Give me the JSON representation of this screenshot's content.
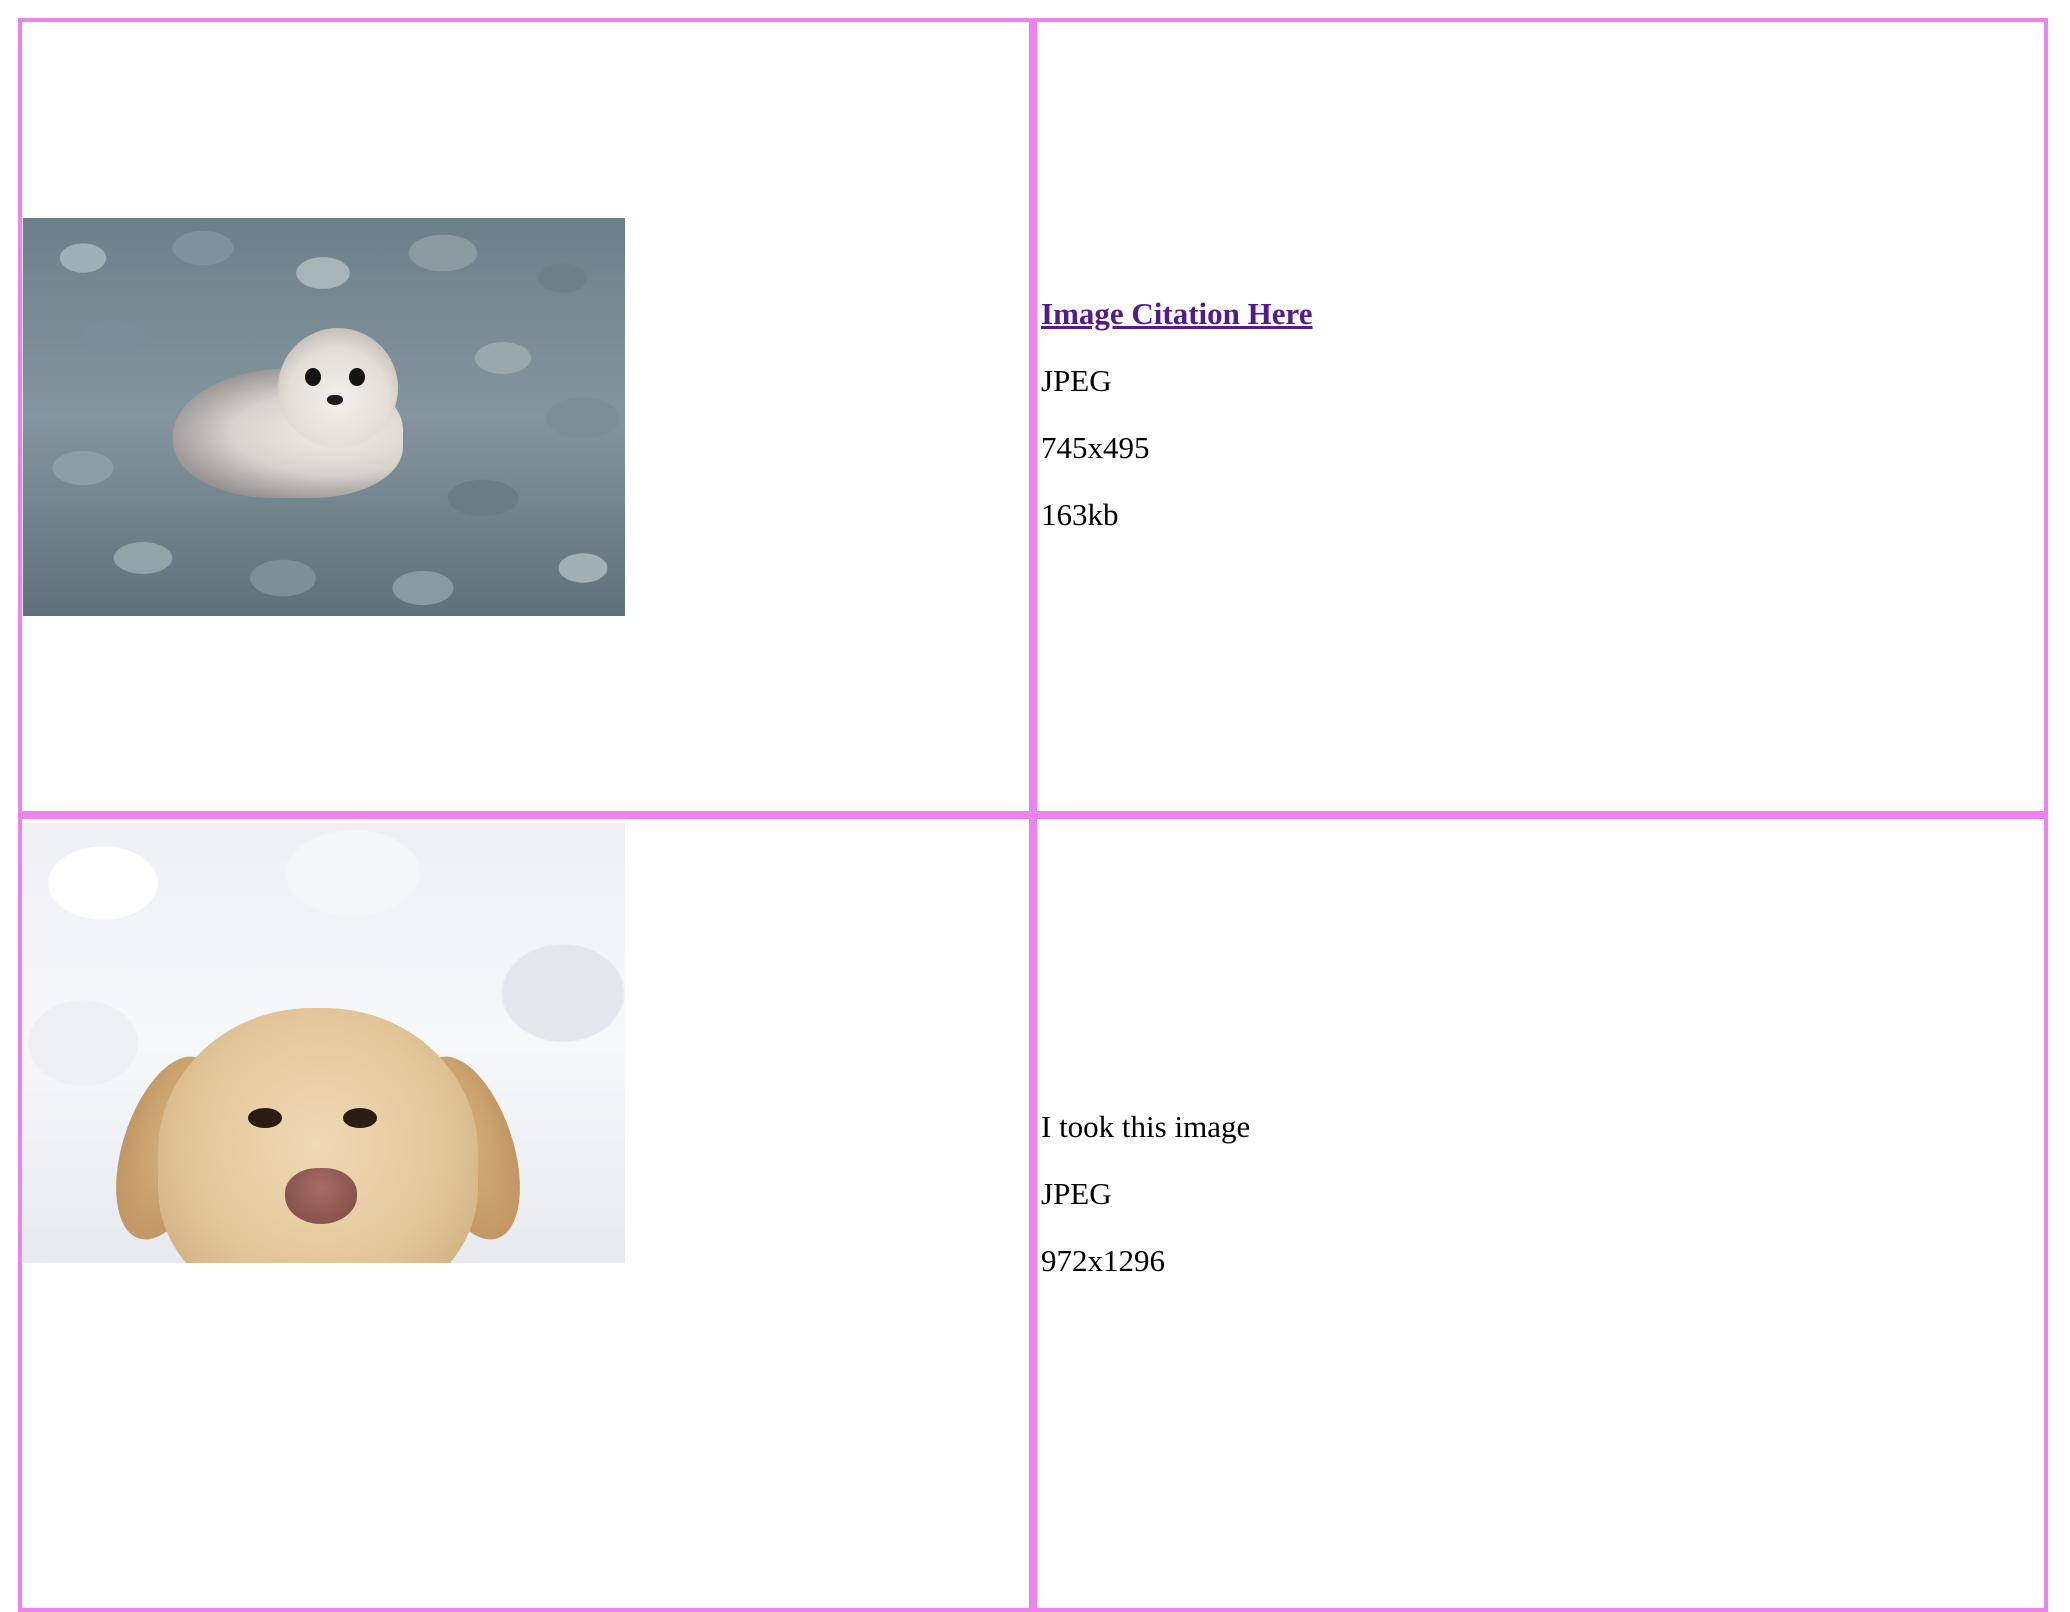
{
  "rows": [
    {
      "image": {
        "subject": "harbor seal on pebbles",
        "icon": "seal-photo"
      },
      "info": {
        "citation": "Image Citation Here",
        "format": "JPEG",
        "dimensions": "745x495",
        "size": "163kb"
      }
    },
    {
      "image": {
        "subject": "yellow labrador in snow",
        "icon": "dog-photo"
      },
      "info": {
        "citation": "I took this image",
        "format": "JPEG",
        "dimensions": "972x1296"
      }
    }
  ],
  "colors": {
    "border": "#ee82ee",
    "link_visited": "#551a8b",
    "text": "#000000",
    "background": "#ffffff"
  }
}
